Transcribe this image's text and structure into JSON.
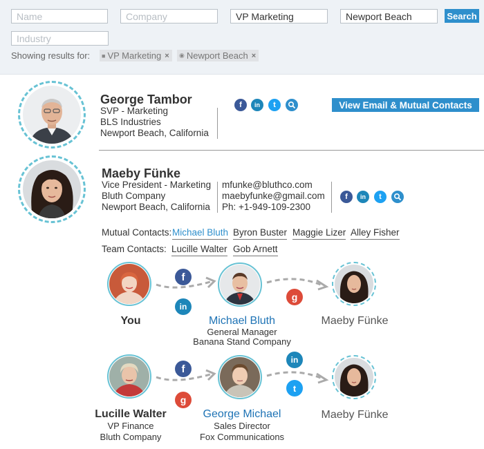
{
  "search": {
    "name_placeholder": "Name",
    "company_placeholder": "Company",
    "title_value": "VP Marketing",
    "location_value": "Newport Beach",
    "industry_placeholder": "Industry",
    "search_label": "Search",
    "showing_label": "Showing results for:",
    "chips": [
      "VP Marketing",
      "Newport Beach"
    ]
  },
  "profiles": [
    {
      "name": "George Tambor",
      "title": "SVP - Marketing",
      "company": "BLS Industries",
      "location": "Newport Beach, California",
      "view_label": "View Email & Mutual Contacts"
    },
    {
      "name": "Maeby Fünke",
      "title": "Vice President - Marketing",
      "company": "Bluth Company",
      "location": "Newport Beach, California",
      "email1": "mfunke@bluthco.com",
      "email2": "maebyfunke@gmail.com",
      "phone": "Ph: +1-949-109-2300",
      "mutual_label": "Mutual Contacts:",
      "mutual": [
        "Michael Bluth",
        "Byron Buster",
        "Maggie Lizer",
        "Alley Fisher"
      ],
      "team_label": "Team Contacts:",
      "team": [
        "Lucille Walter",
        "Gob Arnett"
      ]
    }
  ],
  "paths": [
    {
      "start": {
        "name": "You"
      },
      "middle": {
        "name": "Michael Bluth",
        "title": "General Manager",
        "company": "Banana Stand Company"
      },
      "end": {
        "name": "Maeby Fünke"
      }
    },
    {
      "start": {
        "name": "Lucille Walter",
        "title": "VP Finance",
        "company": "Bluth Company"
      },
      "middle": {
        "name": "George Michael",
        "title": "Sales Director",
        "company": "Fox Communications"
      },
      "end": {
        "name": "Maeby Fünke"
      }
    }
  ],
  "colors": {
    "accent": "#2e8fcc",
    "ring": "#67c2d4",
    "facebook": "#3b5998",
    "linkedin": "#1d86b9",
    "twitter": "#1da1f2",
    "google": "#dd4b39",
    "link_blue": "#1e73b5"
  },
  "icons": [
    "facebook-icon",
    "linkedin-icon",
    "twitter-icon",
    "search-icon",
    "google-plus-icon",
    "tag-icon",
    "location-pin-icon",
    "close-icon",
    "arrow-icon"
  ]
}
